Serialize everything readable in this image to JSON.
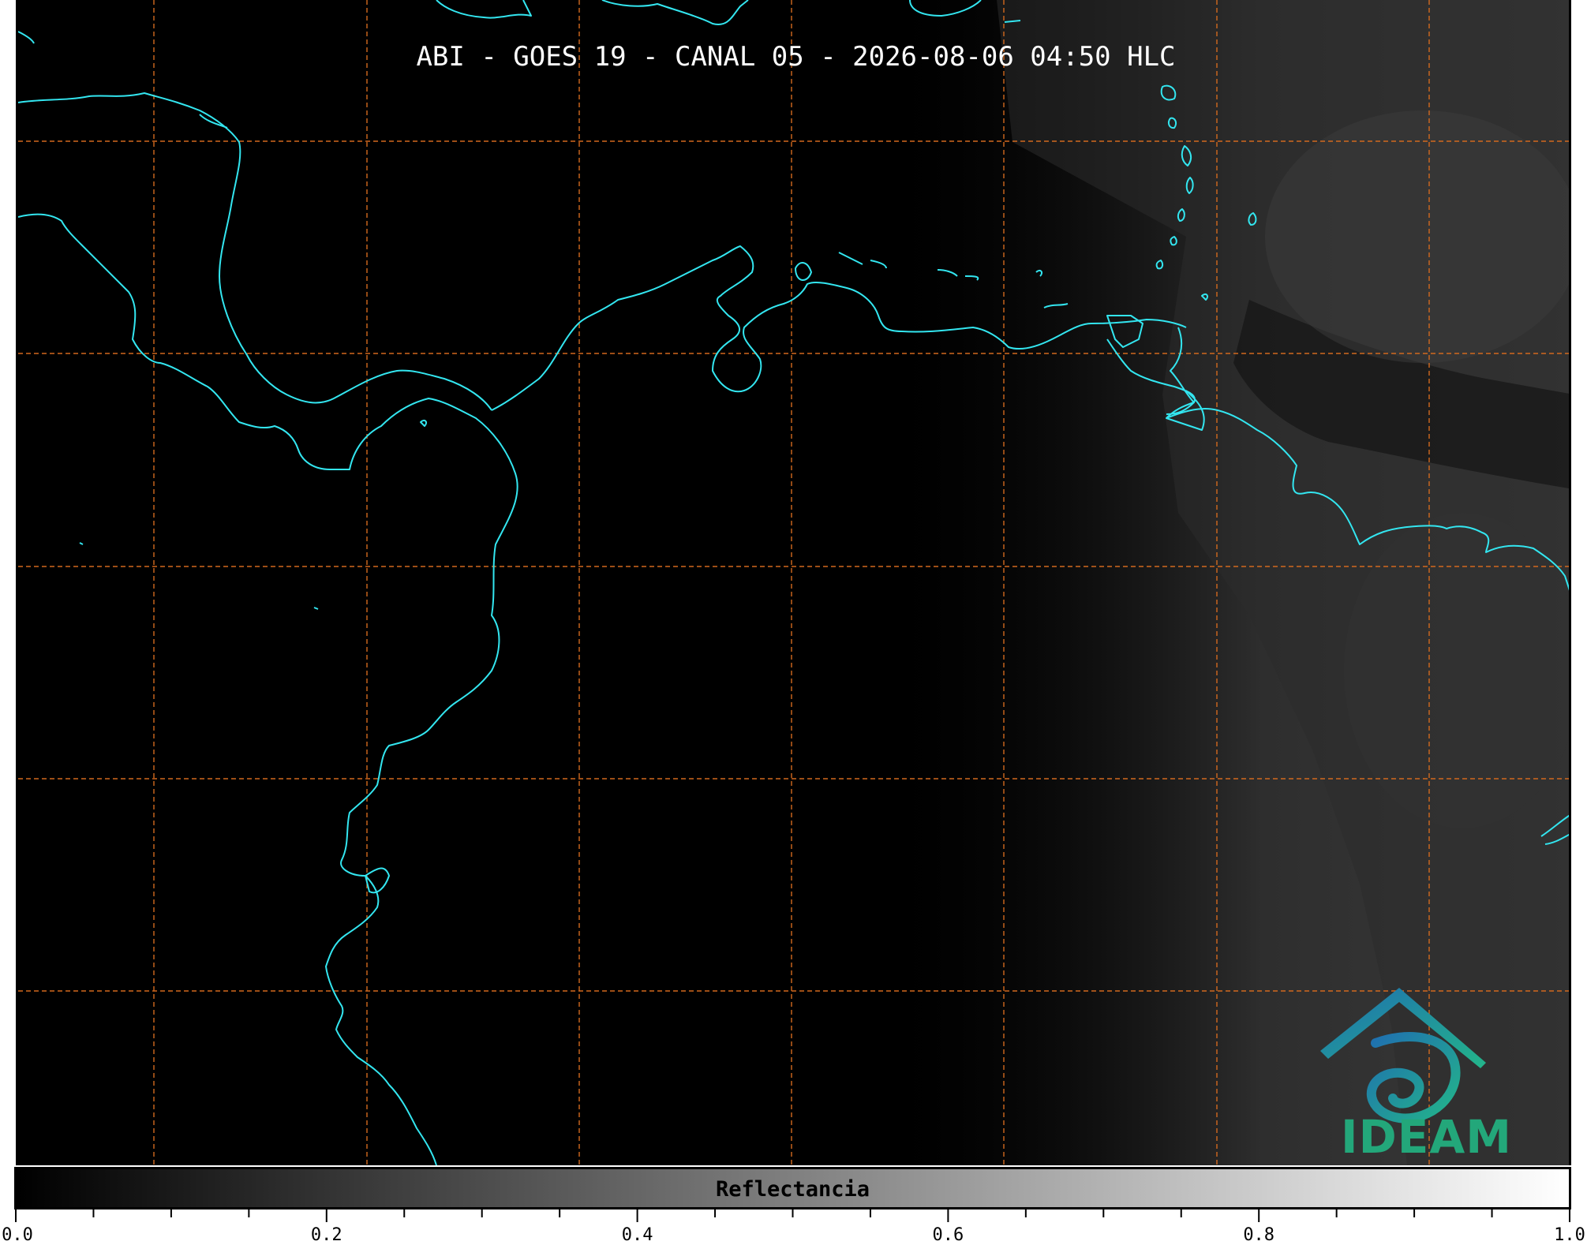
{
  "title": "ABI - GOES 19 - CANAL 05 - 2026-08-06 04:50 HLC",
  "colorbar": {
    "label": "Reflectancia",
    "min": 0.0,
    "max": 1.0,
    "major_ticks": [
      "0.0",
      "0.2",
      "0.4",
      "0.6",
      "0.8",
      "1.0"
    ],
    "minor_tick_step": 0.05,
    "colormap": "gray"
  },
  "logo": {
    "text": "IDEAM",
    "icon": "ideam-logo-icon"
  },
  "colors": {
    "background": "#000000",
    "coastline": "#33e6f0",
    "gridlines": "#d2691e",
    "logo_teal": "#23a77a",
    "logo_blue": "#1f6fb0"
  },
  "map": {
    "gridlines": "dashed",
    "coastline_color_name": "cyan"
  }
}
